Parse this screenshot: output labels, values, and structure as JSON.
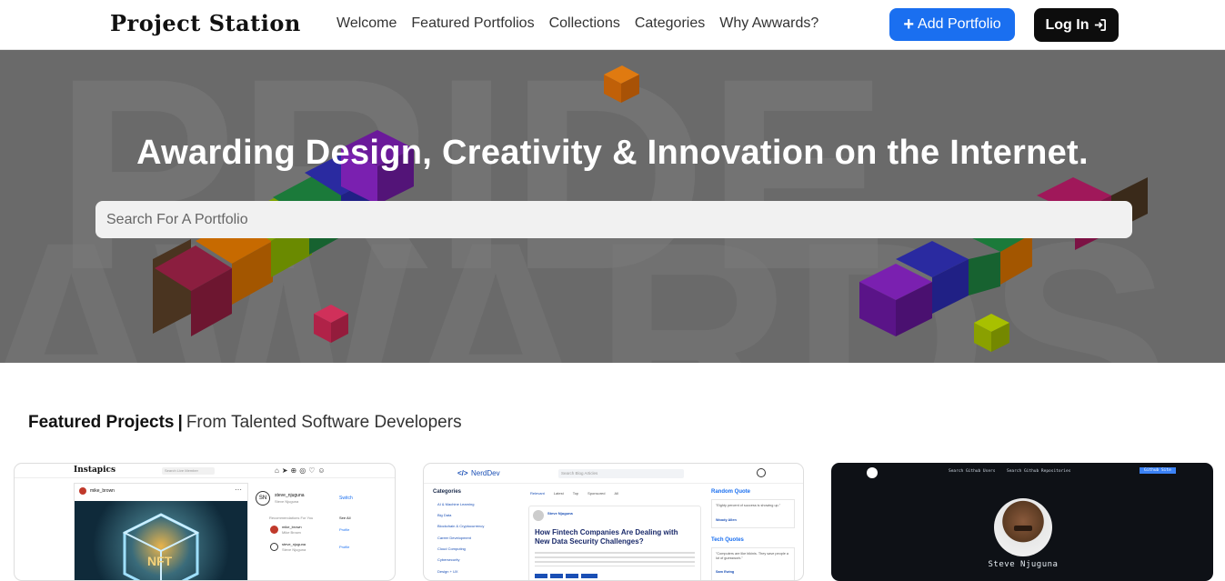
{
  "navbar": {
    "logo": "Project Station",
    "links": [
      "Welcome",
      "Featured Portfolios",
      "Collections",
      "Categories",
      "Why Awwards?"
    ],
    "add_button": "Add Portfolio",
    "login_button": "Log In",
    "colors": {
      "add": "#1a6ff0",
      "login": "#0d0d0d"
    }
  },
  "hero": {
    "title": "Awarding Design, Creativity & Innovation on the Internet.",
    "search_placeholder": "Search For A Portfolio"
  },
  "featured": {
    "heading_strong": "Featured Projects",
    "separator": "|",
    "heading_light": "From Talented Software Developers"
  },
  "cards": [
    {
      "app_name": "Instapics",
      "search_placeholder": "Search Live Member",
      "post_user": "mike_brown",
      "image_text": "NFT",
      "suggest_user": "steve_njuguna",
      "suggest_sub": "Steve Njuguna",
      "switch": "Switch",
      "recommendations": "Recommendations For You",
      "see_all": "See All",
      "rec1": "mike_brown",
      "rec1_sub": "Mike Brown",
      "rec2": "steve_njuguna",
      "rec2_sub": "Steve Njuguna",
      "profile": "Profile"
    },
    {
      "app_name": "NerdDev",
      "search_placeholder": "Search Blog Articles",
      "categories_title": "Categories",
      "categories": [
        "AI & Machine Learning",
        "Big Data",
        "Blockchain & Cryptocurrency",
        "Career Development",
        "Cloud Computing",
        "Cybersecurity",
        "Design + UX"
      ],
      "tabs": [
        "Relevant",
        "Latest",
        "Top",
        "Sponsored",
        "All"
      ],
      "author": "Steve Njuguna",
      "article_title": "How Fintech Companies Are Dealing with New Data Security Challenges?",
      "random_quote_title": "Random Quote",
      "quote1": "\"Eighty percent of success is showing up.\"",
      "quote1_author": "Woody Allen",
      "tech_quotes_title": "Tech Quotes",
      "quote2": "\"Computers are like bikinis. They save people a lot of guesswork.\"",
      "quote2_author": "Sam Ewing"
    },
    {
      "nav1": "Search Github Users",
      "nav2": "Search Github Repositories",
      "button": "Github Site",
      "profile_name": "Steve Njuguna"
    }
  ]
}
